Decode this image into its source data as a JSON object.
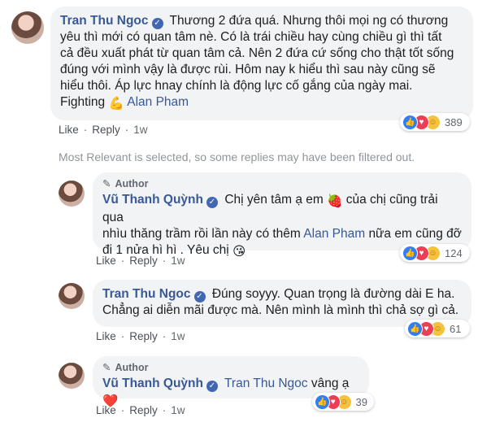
{
  "comments": [
    {
      "name": "Tran Thu Ngoc",
      "text_lines": [
        "Thương 2 đứa quá. Nhưng thôi mọi ng có thương",
        "yêu thì mới có quan tâm nè. Có là trái chiều hay cùng chiều gì thì tất",
        "cả đều xuất phát từ quan tâm cả. Nên 2 đứa cứ sống cho thật tốt sống",
        "đúng với mình vậy là được rùi. Hôm nay k hiểu thì sau này cũng sẽ",
        "hiểu thôi. Áp lực hnay chính là động lực cố gắng của ngày mai."
      ],
      "last_line_text": "Fighting",
      "last_line_emoji": "💪",
      "mention": "Alan Pham",
      "like_label": "Like",
      "reply_label": "Reply",
      "time": "1w",
      "reaction_count": "389"
    }
  ],
  "notice": "Most Relevant is selected, so some replies may have been filtered out.",
  "replies": [
    {
      "author_label": "Author",
      "name": "Vũ Thanh Quỳnh",
      "line1": "Chị yên tâm ạ em",
      "emoji1": "🍓",
      "line1b": "của chị cũng trải qua",
      "line2a": "nhìu thăng trầm rồi lần này có thêm",
      "mention": "Alan Pham",
      "line2b": "nữa em cũng đỡ",
      "line3": "đi 1 nửa hì hì . Yêu chị",
      "emoji3": "😘",
      "like_label": "Like",
      "reply_label": "Reply",
      "time": "1w",
      "reaction_count": "124"
    },
    {
      "name": "Tran Thu Ngoc",
      "line1": "Đúng soyyy. Quan trọng là đường dài E ha.",
      "line2": "Chẳng ai diễn mãi được mà. Nên mình là mình thì chả sợ gì cả.",
      "like_label": "Like",
      "reply_label": "Reply",
      "time": "1w",
      "reaction_count": "61"
    },
    {
      "author_label": "Author",
      "name": "Vũ Thanh Quỳnh",
      "mention": "Tran Thu Ngoc",
      "text": "vâng ạ",
      "emoji": "❤️",
      "like_label": "Like",
      "reply_label": "Reply",
      "time": "1w",
      "reaction_count": "39"
    }
  ],
  "colors": {
    "link": "#385898",
    "bubble": "#f2f3f5",
    "like_blue": "#2f7ff8",
    "love_red": "#ee3e55",
    "care_yellow": "#f5c33b"
  },
  "icons": [
    "pencil-icon",
    "verified-badge-icon",
    "like-reaction-icon",
    "love-reaction-icon",
    "care-reaction-icon"
  ]
}
